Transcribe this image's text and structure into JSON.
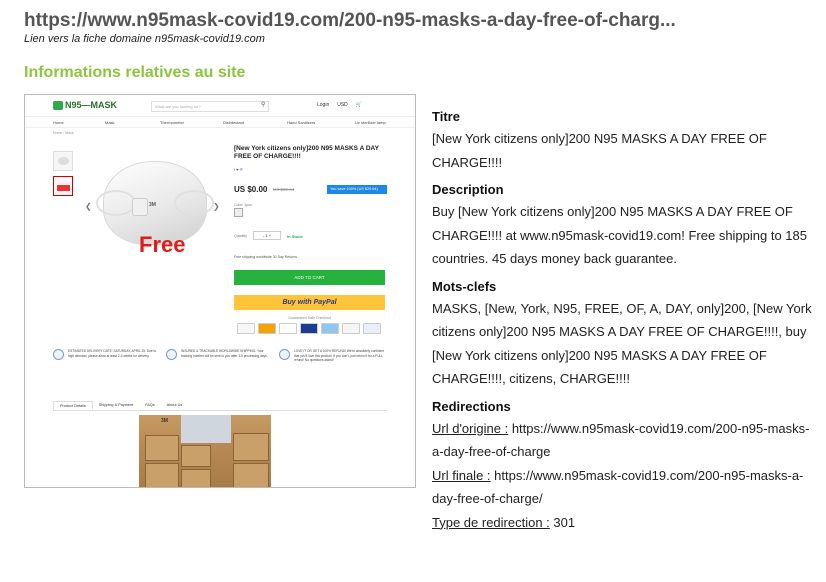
{
  "header": {
    "url": "https://www.n95mask-covid19.com/200-n95-masks-a-day-free-of-charg...",
    "domain_link": "Lien vers la fiche domaine n95mask-covid19.com",
    "section_title": "Informations relatives au site"
  },
  "thumbnail": {
    "logo": "N95—MASK",
    "search_placeholder": "What are you looking for?",
    "account": "Login",
    "currency": "USD",
    "nav": [
      "Home",
      "Mask",
      "Thermometer",
      "Disinfectant",
      "Hand Sanitizers",
      "Uv sterilizer lamp"
    ],
    "breadcrumb": "Home / Mask",
    "product_title": "[New York citizens only]200 N95 MASKS A DAY FREE OF CHARGE!!!!",
    "social": "f ♥ ℗",
    "price": "US $0.00",
    "price_old": "US $29.64",
    "save_badge": "You save 100% (US $29.64)",
    "color_label": "Color: 1pcs",
    "quantity_label": "Quantity",
    "quantity_value": "-  1  +",
    "stock": "In Stock",
    "shipping": "Free shipping worldwide   30 Day Returns",
    "add_to_cart": "ADD TO CART",
    "paypal": "Buy with PayPal",
    "safe_checkout": "Guaranteed Safe Checkout",
    "free_overlay": "Free",
    "mask_mark": "3M",
    "trust": [
      "ESTIMATED DELIVERY DATE: SATURDAY, APRIL 25. Due to high demand, please allow at least 2-3 weeks for delivery.",
      "INSURED & TRACKABLE WORLDWIDE SHIPPING. Your tracking number will be sent to you after 3-5 processing days.",
      "LOVE IT OR GET A 100% REFUND! We're absolutely confident that you'll love this product. If you don't, just return it for a FULL refund! No questions asked!"
    ],
    "tabs": [
      "Product Details",
      "Shipping & Payment",
      "FAQs",
      "About Us"
    ],
    "photo_mark": "3M"
  },
  "info": {
    "titre_label": "Titre",
    "titre_value": "[New York citizens only]200 N95 MASKS A DAY FREE OF CHARGE!!!!",
    "description_label": "Description",
    "description_value": "Buy [New York citizens only]200 N95 MASKS A DAY FREE OF CHARGE!!!! at www.n95mask-covid19.com! Free shipping to 185 countries. 45 days money back guarantee.",
    "keywords_label": "Mots-clefs",
    "keywords_value": "MASKS, [New, York, N95, FREE, OF, A, DAY, only]200, [New York citizens only]200 N95 MASKS A DAY FREE OF CHARGE!!!!, buy [New York citizens only]200 N95 MASKS A DAY FREE OF CHARGE!!!!, citizens, CHARGE!!!!",
    "redirections_label": "Redirections",
    "origin_label": "Url d'origine :",
    "origin_value": "https://www.n95mask-covid19.com/200-n95-masks-a-day-free-of-charge",
    "final_label": "Url finale :",
    "final_value": "https://www.n95mask-covid19.com/200-n95-masks-a-day-free-of-charge/",
    "redirect_type_label": "Type de redirection :",
    "redirect_type_value": "301"
  }
}
